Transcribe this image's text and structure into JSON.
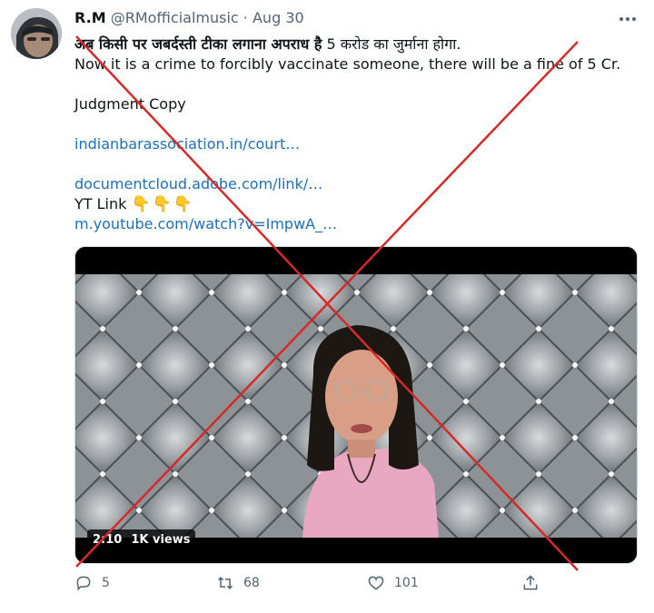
{
  "tweet": {
    "display_name": "R.M",
    "handle": "@RMofficialmusic",
    "separator": "·",
    "date": "Aug 30",
    "text_hindi_bold": "अब किसी पर जबर्दस्ती टीका लगाना अपराध है",
    "text_hindi_rest": " 5 करोड का जुर्माना होगा.",
    "text_english": "Now it is a crime to forcibly vaccinate someone, there will be a fine of 5 Cr.",
    "judgment_label": "Judgment Copy",
    "link1": "indianbarassociation.in/court…",
    "link2": "documentcloud.adobe.com/link/…",
    "yt_label": "YT Link",
    "yt_emoji": "👇👇👇",
    "link3": "m.youtube.com/watch?v=ImpwA_…"
  },
  "video": {
    "duration": "2:10",
    "views": "1K views"
  },
  "actions": {
    "replies": "5",
    "retweets": "68",
    "likes": "101"
  },
  "icons": {
    "reply": "reply-icon",
    "retweet": "retweet-icon",
    "like": "heart-icon",
    "share": "share-icon",
    "more": "more-options-icon"
  },
  "colors": {
    "link": "#1d6fb8",
    "muted": "#536471",
    "cross": "#d42a2a"
  }
}
